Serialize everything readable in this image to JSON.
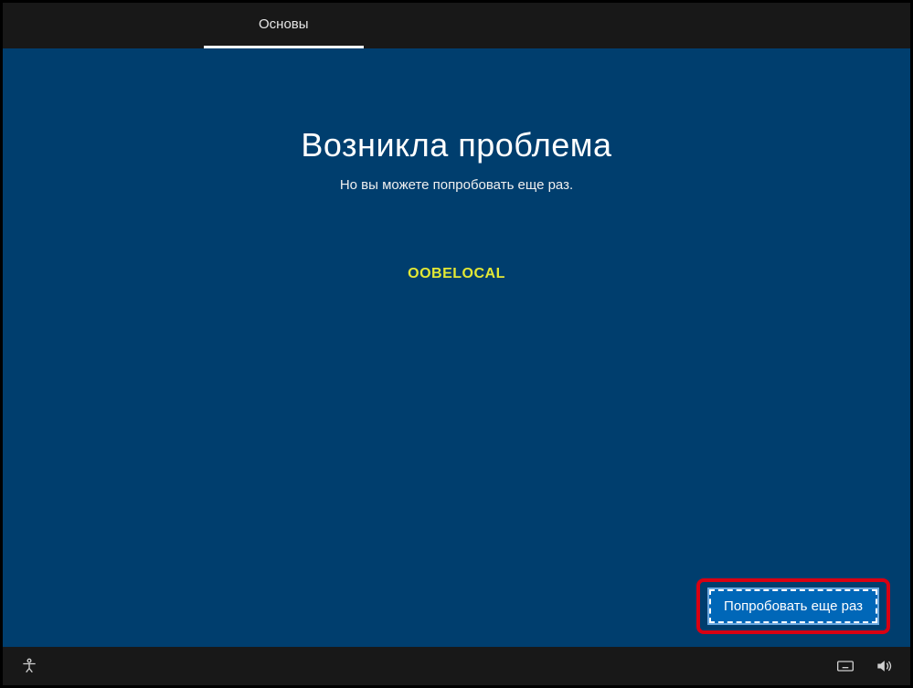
{
  "topbar": {
    "tab_label": "Основы"
  },
  "message": {
    "heading": "Возникла проблема",
    "subtext": "Но вы можете попробовать еще раз.",
    "error_code": "OOBELOCAL"
  },
  "actions": {
    "retry_label": "Попробовать еще раз"
  },
  "icons": {
    "ease_of_access": "ease-of-access",
    "keyboard": "keyboard",
    "volume": "volume"
  }
}
